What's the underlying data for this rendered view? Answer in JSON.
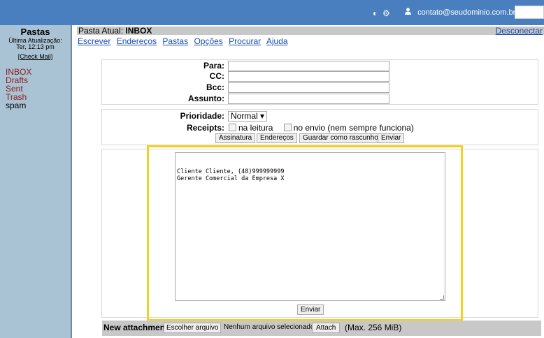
{
  "topbar": {
    "theme_icon": "◐",
    "settings_icon": "⚙",
    "user_icon": "👤",
    "user_email": "contato@seudominio.com.br ▾"
  },
  "sidebar": {
    "title": "Pastas",
    "last_update_label": "Última Atualização:",
    "last_update_time": "Ter, 12:13 pm",
    "check_mail": "[Check Mail]",
    "folders": [
      "INBOX",
      "Drafts",
      "Sent",
      "Trash",
      "spam"
    ]
  },
  "header": {
    "current_folder_label": "Pasta Atual: ",
    "current_folder": "INBOX",
    "logout": "Desconectar"
  },
  "nav": [
    "Escrever",
    "Endereços",
    "Pastas",
    "Opções",
    "Procurar",
    "Ajuda"
  ],
  "compose": {
    "to_label": "Para:",
    "cc_label": "CC:",
    "bcc_label": "Bcc:",
    "subject_label": "Assunto:",
    "to_value": "",
    "cc_value": "",
    "bcc_value": "",
    "subject_value": ""
  },
  "options": {
    "priority_label": "Prioridade:",
    "priority_value": "Normal ▾",
    "receipts_label": "Receipts:",
    "receipt_read": "na leitura",
    "receipt_delivery": "no envio (nem sempre funciona)",
    "btn_signature": "Assinatura",
    "btn_addresses": "Endereços",
    "btn_save_draft": "Guardar como rascunho",
    "btn_send": "Enviar"
  },
  "body": {
    "text": "Cliente Cliente, (48)999999999\nGerente Comercial da Empresa X",
    "send": "Enviar"
  },
  "attachment": {
    "label": "New attachment:",
    "choose": "Escolher arquivo",
    "none_selected": "Nenhum arquivo selecionado",
    "attach": "Attach",
    "max": "(Max. 256 MiB)"
  },
  "colors": {
    "topbar": "#4a7fbf",
    "sidebar": "#aac3d4",
    "highlight": "#f3d21f",
    "link": "#1a4fb0",
    "folder": "#8b1a1a"
  }
}
